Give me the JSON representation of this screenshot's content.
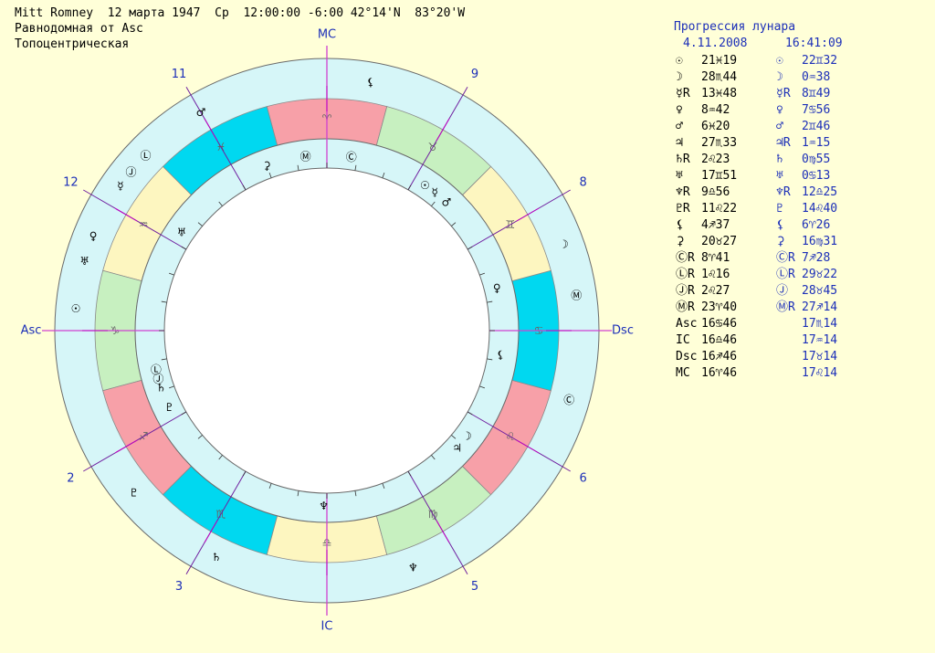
{
  "header": {
    "line1": "Mitt Romney  12 марта 1947  Ср  12:00:00 -6:00 42°14'N  83°20'W",
    "line2": "Равнодомная от Asc",
    "line3": "Топоцентрическая"
  },
  "panel": {
    "title": "Прогрессия лунара",
    "date": "4.11.2008",
    "time": "16:41:09",
    "rows": [
      {
        "natal_glyph": "☉",
        "natal_pos": "21♓19",
        "prog_glyph": "☉",
        "prog_pos": "22♊32"
      },
      {
        "natal_glyph": "☽",
        "natal_pos": "28♏44",
        "prog_glyph": "☽",
        "prog_pos": "0♒38"
      },
      {
        "natal_glyph": "☿R",
        "natal_pos": "13♓48",
        "prog_glyph": "☿R",
        "prog_pos": "8♊49"
      },
      {
        "natal_glyph": "♀",
        "natal_pos": "8♒42",
        "prog_glyph": "♀",
        "prog_pos": "7♋56"
      },
      {
        "natal_glyph": "♂",
        "natal_pos": "6♓20",
        "prog_glyph": "♂",
        "prog_pos": "2♊46"
      },
      {
        "natal_glyph": "♃",
        "natal_pos": "27♏33",
        "prog_glyph": "♃R",
        "prog_pos": "1♒15"
      },
      {
        "natal_glyph": "♄R",
        "natal_pos": "2♌23",
        "prog_glyph": "♄",
        "prog_pos": "0♍55"
      },
      {
        "natal_glyph": "♅",
        "natal_pos": "17♊51",
        "prog_glyph": "♅",
        "prog_pos": "0♋13"
      },
      {
        "natal_glyph": "♆R",
        "natal_pos": "9♎56",
        "prog_glyph": "♆R",
        "prog_pos": "12♎25"
      },
      {
        "natal_glyph": "♇R",
        "natal_pos": "11♌22",
        "prog_glyph": "♇",
        "prog_pos": "14♌40"
      },
      {
        "natal_glyph": "⚸",
        "natal_pos": "4♐37",
        "prog_glyph": "⚸",
        "prog_pos": "6♈26"
      },
      {
        "natal_glyph": "⚳",
        "natal_pos": "20♉27",
        "prog_glyph": "⚳",
        "prog_pos": "16♍31"
      },
      {
        "natal_glyph": "ⒸR",
        "natal_pos": "8♈41",
        "prog_glyph": "ⒸR",
        "prog_pos": "7♐28"
      },
      {
        "natal_glyph": "ⓁR",
        "natal_pos": "1♌16",
        "prog_glyph": "ⓁR",
        "prog_pos": "29♉22"
      },
      {
        "natal_glyph": "ⒿR",
        "natal_pos": "2♌27",
        "prog_glyph": "Ⓙ",
        "prog_pos": "28♉45"
      },
      {
        "natal_glyph": "ⓂR",
        "natal_pos": "23♈40",
        "prog_glyph": "ⓂR",
        "prog_pos": "27♐14"
      },
      {
        "natal_glyph": "Asc",
        "natal_pos": "16♋46",
        "prog_glyph": "",
        "prog_pos": "17♏14"
      },
      {
        "natal_glyph": "IC",
        "natal_pos": "16♎46",
        "prog_glyph": "",
        "prog_pos": "17♒14"
      },
      {
        "natal_glyph": "Dsc",
        "natal_pos": "16♐46",
        "prog_glyph": "",
        "prog_pos": "17♉14"
      },
      {
        "natal_glyph": "MC",
        "natal_pos": "16♈46",
        "prog_glyph": "",
        "prog_pos": "17♌14"
      }
    ]
  },
  "wheel": {
    "signs": [
      {
        "glyph": "♈",
        "color": "#f7a0a8"
      },
      {
        "glyph": "♓",
        "color": "#00d8f0"
      },
      {
        "glyph": "♒",
        "color": "#fdf6c0"
      },
      {
        "glyph": "♑",
        "color": "#c7f0c0"
      },
      {
        "glyph": "♐",
        "color": "#f7a0a8"
      },
      {
        "glyph": "♏",
        "color": "#00d8f0"
      },
      {
        "glyph": "♎",
        "color": "#fdf6c0"
      },
      {
        "glyph": "♍",
        "color": "#c7f0c0"
      },
      {
        "glyph": "♌",
        "color": "#f7a0a8"
      },
      {
        "glyph": "♋",
        "color": "#00d8f0"
      },
      {
        "glyph": "♊",
        "color": "#fdf6c0"
      },
      {
        "glyph": "♉",
        "color": "#c7f0c0"
      }
    ],
    "outer_labels": [
      {
        "text": "Asc"
      },
      {
        "text": "2"
      },
      {
        "text": "3"
      },
      {
        "text": "IC"
      },
      {
        "text": "5"
      },
      {
        "text": "6"
      },
      {
        "text": "Dsc"
      },
      {
        "text": "8"
      },
      {
        "text": "9"
      },
      {
        "text": "MC"
      },
      {
        "text": "11"
      },
      {
        "text": "12"
      }
    ],
    "outer_planets": [
      {
        "glyph": "⚸"
      },
      {
        "glyph": "☽"
      },
      {
        "glyph": "Ⓜ"
      },
      {
        "glyph": "Ⓒ"
      },
      {
        "glyph": "♆"
      },
      {
        "glyph": "♄"
      },
      {
        "glyph": "♇"
      },
      {
        "glyph": "♀"
      },
      {
        "glyph": "♅"
      },
      {
        "glyph": "☉"
      },
      {
        "glyph": "☿"
      },
      {
        "glyph": "♂"
      },
      {
        "glyph": "Ⓛ"
      },
      {
        "glyph": "Ⓙ"
      }
    ],
    "inner_planets": [
      {
        "glyph": "☉"
      },
      {
        "glyph": "☿"
      },
      {
        "glyph": "♂"
      },
      {
        "glyph": "Ⓜ"
      },
      {
        "glyph": "Ⓒ"
      },
      {
        "glyph": "⚳"
      },
      {
        "glyph": "♅"
      },
      {
        "glyph": "♀"
      },
      {
        "glyph": "⚸"
      },
      {
        "glyph": "☽"
      },
      {
        "glyph": "♃"
      },
      {
        "glyph": "♆"
      },
      {
        "glyph": "Ⓙ"
      },
      {
        "glyph": "Ⓛ"
      },
      {
        "glyph": "♄"
      },
      {
        "glyph": "♇"
      }
    ]
  }
}
